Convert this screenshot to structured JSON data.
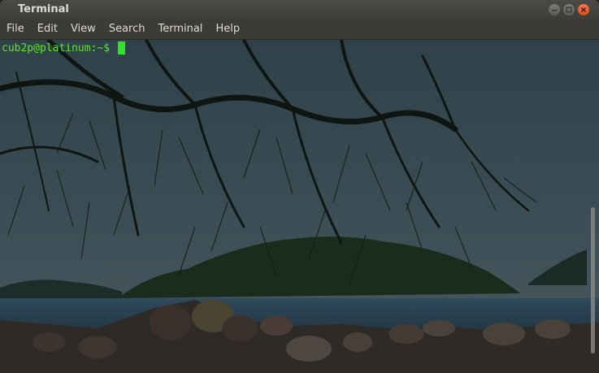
{
  "window": {
    "title": "Terminal"
  },
  "menu": {
    "items": [
      "File",
      "Edit",
      "View",
      "Search",
      "Terminal",
      "Help"
    ]
  },
  "terminal": {
    "prompt": "cub2p@platinum:~$",
    "colors": {
      "prompt": "#5fe32a",
      "cursor": "#2fe32a"
    }
  },
  "icons": {
    "minimize": "minimize-icon",
    "maximize": "maximize-icon",
    "close": "close-icon"
  }
}
